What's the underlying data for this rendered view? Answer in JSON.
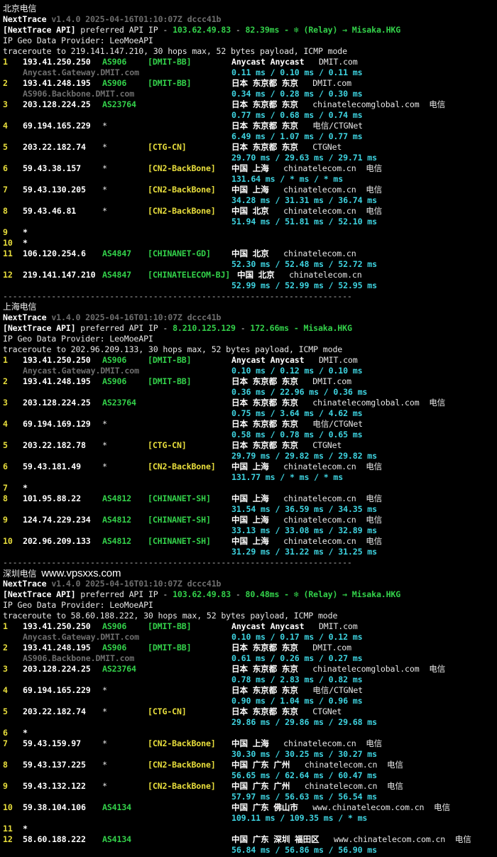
{
  "sections": [
    {
      "title": "北京电信",
      "watermark": "",
      "version_line": {
        "name": "NextTrace",
        "version": "v1.4.0 2025-04-16T01:10:07Z dccc41b"
      },
      "api_line": {
        "tag": "[NextTrace API]",
        "mid": " preferred API IP - ",
        "ip": "103.62.49.83",
        "dash": " - ",
        "latency": "82.39ms",
        "tail": " - ❄ (Relay) → Misaka.HKG"
      },
      "provider_line": "IP Geo Data Provider: LeoMoeAPI",
      "trace_line": "traceroute to 219.141.147.210, 30 hops max, 52 bytes payload, ICMP mode",
      "hops": [
        {
          "n": "1",
          "ip": "193.41.250.250",
          "asn": "AS906",
          "tag": "[DMIT-BB]",
          "loc": "Anycast Anycast",
          "isp": "DMIT.com",
          "carrier": "",
          "host": "Anycast.Gateway.DMIT.com",
          "rtt": "0.11 ms / 0.10 ms / 0.11 ms",
          "tag_color": "g"
        },
        {
          "n": "2",
          "ip": "193.41.248.195",
          "asn": "AS906",
          "tag": "[DMIT-BB]",
          "loc": "日本 东京都 东京",
          "isp": "DMIT.com",
          "carrier": "",
          "host": "AS906.Backbone.DMIT.com",
          "rtt": "0.34 ms / 0.28 ms / 0.30 ms",
          "tag_color": "g"
        },
        {
          "n": "3",
          "ip": "203.128.224.25",
          "asn": "AS23764",
          "tag": "",
          "loc": "日本 东京都 东京",
          "isp": "chinatelecomglobal.com",
          "carrier": "电信",
          "host": "",
          "rtt": "0.77 ms / 0.68 ms / 0.74 ms",
          "tag_color": "g"
        },
        {
          "n": "4",
          "ip": "69.194.165.229",
          "asn": "*",
          "tag": "",
          "loc": "日本 东京都 东京",
          "isp": "电信/CTGNet",
          "carrier": "",
          "host": "",
          "rtt": "6.49 ms / 1.07 ms / 0.77 ms",
          "tag_color": "g"
        },
        {
          "n": "5",
          "ip": "203.22.182.74",
          "asn": "*",
          "tag": "[CTG-CN]",
          "loc": "日本 东京都 东京",
          "isp": "CTGNet",
          "carrier": "",
          "host": "",
          "rtt": "29.70 ms / 29.63 ms / 29.71 ms",
          "tag_color": "y"
        },
        {
          "n": "6",
          "ip": "59.43.38.157",
          "asn": "*",
          "tag": "[CN2-BackBone]",
          "loc": "中国 上海",
          "isp": "chinatelecom.cn",
          "carrier": "电信",
          "host": "",
          "rtt": "131.64 ms / * ms / * ms",
          "tag_color": "y"
        },
        {
          "n": "7",
          "ip": "59.43.130.205",
          "asn": "*",
          "tag": "[CN2-BackBone]",
          "loc": "中国 上海",
          "isp": "chinatelecom.cn",
          "carrier": "电信",
          "host": "",
          "rtt": "34.28 ms / 31.31 ms / 36.74 ms",
          "tag_color": "y"
        },
        {
          "n": "8",
          "ip": "59.43.46.81",
          "asn": "*",
          "tag": "[CN2-BackBone]",
          "loc": "中国 北京",
          "isp": "chinatelecom.cn",
          "carrier": "电信",
          "host": "",
          "rtt": "51.94 ms / 51.81 ms / 52.10 ms",
          "tag_color": "y"
        },
        {
          "n": "9",
          "ip": "*",
          "timeout": true
        },
        {
          "n": "10",
          "ip": "*",
          "timeout": true
        },
        {
          "n": "11",
          "ip": "106.120.254.6",
          "asn": "AS4847",
          "tag": "[CHINANET-GD]",
          "loc": "中国 北京",
          "isp": "chinatelecom.cn",
          "carrier": "",
          "host": "",
          "rtt": "52.30 ms / 52.48 ms / 52.72 ms",
          "tag_color": "g",
          "blank_before_rtt": true
        },
        {
          "n": "12",
          "ip": "219.141.147.210",
          "asn": "AS4847",
          "tag": "[CHINATELECOM-BJ]",
          "loc": "中国 北京",
          "isp": "chinatelecom.cn",
          "carrier": "",
          "host": "",
          "rtt": "52.99 ms / 52.99 ms / 52.95 ms",
          "tag_color": "g",
          "wide": true
        }
      ]
    },
    {
      "title": "上海电信",
      "watermark": "",
      "version_line": {
        "name": "NextTrace",
        "version": "v1.4.0 2025-04-16T01:10:07Z dccc41b"
      },
      "api_line": {
        "tag": "[NextTrace API]",
        "mid": " preferred API IP - ",
        "ip": "8.210.125.129",
        "dash": " - ",
        "latency": "172.66ms",
        "tail": " - Misaka.HKG"
      },
      "provider_line": "IP Geo Data Provider: LeoMoeAPI",
      "trace_line": "traceroute to 202.96.209.133, 30 hops max, 52 bytes payload, ICMP mode",
      "hops": [
        {
          "n": "1",
          "ip": "193.41.250.250",
          "asn": "AS906",
          "tag": "[DMIT-BB]",
          "loc": "Anycast Anycast",
          "isp": "DMIT.com",
          "carrier": "",
          "host": "Anycast.Gateway.DMIT.com",
          "rtt": "0.10 ms / 0.12 ms / 0.10 ms",
          "tag_color": "g"
        },
        {
          "n": "2",
          "ip": "193.41.248.195",
          "asn": "AS906",
          "tag": "[DMIT-BB]",
          "loc": "日本 东京都 东京",
          "isp": "DMIT.com",
          "carrier": "",
          "host": "",
          "rtt": "0.36 ms / 22.96 ms / 0.36 ms",
          "tag_color": "g"
        },
        {
          "n": "3",
          "ip": "203.128.224.25",
          "asn": "AS23764",
          "tag": "",
          "loc": "日本 东京都 东京",
          "isp": "chinatelecomglobal.com",
          "carrier": "电信",
          "host": "",
          "rtt": "0.75 ms / 3.64 ms / 4.62 ms",
          "tag_color": "g"
        },
        {
          "n": "4",
          "ip": "69.194.169.129",
          "asn": "*",
          "tag": "",
          "loc": "日本 东京都 东京",
          "isp": "电信/CTGNet",
          "carrier": "",
          "host": "",
          "rtt": "0.58 ms / 0.78 ms / 0.65 ms",
          "tag_color": "g"
        },
        {
          "n": "5",
          "ip": "203.22.182.78",
          "asn": "*",
          "tag": "[CTG-CN]",
          "loc": "日本 东京都 东京",
          "isp": "CTGNet",
          "carrier": "",
          "host": "",
          "rtt": "29.79 ms / 29.82 ms / 29.82 ms",
          "tag_color": "y"
        },
        {
          "n": "6",
          "ip": "59.43.181.49",
          "asn": "*",
          "tag": "[CN2-BackBone]",
          "loc": "中国 上海",
          "isp": "chinatelecom.cn",
          "carrier": "电信",
          "host": "",
          "rtt": "131.77 ms / * ms / * ms",
          "tag_color": "y"
        },
        {
          "n": "7",
          "ip": "*",
          "timeout": true
        },
        {
          "n": "8",
          "ip": "101.95.88.22",
          "asn": "AS4812",
          "tag": "[CHINANET-SH]",
          "loc": "中国 上海",
          "isp": "chinatelecom.cn",
          "carrier": "电信",
          "host": "",
          "rtt": "31.54 ms / 36.59 ms / 34.35 ms",
          "tag_color": "g"
        },
        {
          "n": "9",
          "ip": "124.74.229.234",
          "asn": "AS4812",
          "tag": "[CHINANET-SH]",
          "loc": "中国 上海",
          "isp": "chinatelecom.cn",
          "carrier": "电信",
          "host": "",
          "rtt": "33.13 ms / 33.08 ms / 32.89 ms",
          "tag_color": "g"
        },
        {
          "n": "10",
          "ip": "202.96.209.133",
          "asn": "AS4812",
          "tag": "[CHINANET-SH]",
          "loc": "中国 上海",
          "isp": "chinatelecom.cn",
          "carrier": "电信",
          "host": "",
          "rtt": "31.29 ms / 31.22 ms / 31.25 ms",
          "tag_color": "g"
        }
      ]
    },
    {
      "title": "深圳电信",
      "watermark": "www.vpsxxs.com",
      "version_line": {
        "name": "NextTrace",
        "version": "v1.4.0 2025-04-16T01:10:07Z dccc41b"
      },
      "api_line": {
        "tag": "[NextTrace API]",
        "mid": " preferred API IP - ",
        "ip": "103.62.49.83",
        "dash": " - ",
        "latency": "80.48ms",
        "tail": " - ❄ (Relay) → Misaka.HKG"
      },
      "provider_line": "IP Geo Data Provider: LeoMoeAPI",
      "trace_line": "traceroute to 58.60.188.222, 30 hops max, 52 bytes payload, ICMP mode",
      "hops": [
        {
          "n": "1",
          "ip": "193.41.250.250",
          "asn": "AS906",
          "tag": "[DMIT-BB]",
          "loc": "Anycast Anycast",
          "isp": "DMIT.com",
          "carrier": "",
          "host": "Anycast.Gateway.DMIT.com",
          "rtt": "0.10 ms / 0.17 ms / 0.12 ms",
          "tag_color": "g"
        },
        {
          "n": "2",
          "ip": "193.41.248.195",
          "asn": "AS906",
          "tag": "[DMIT-BB]",
          "loc": "日本 东京都 东京",
          "isp": "DMIT.com",
          "carrier": "",
          "host": "AS906.Backbone.DMIT.com",
          "rtt": "0.61 ms / 0.26 ms / 0.27 ms",
          "tag_color": "g"
        },
        {
          "n": "3",
          "ip": "203.128.224.25",
          "asn": "AS23764",
          "tag": "",
          "loc": "日本 东京都 东京",
          "isp": "chinatelecomglobal.com",
          "carrier": "电信",
          "host": "",
          "rtt": "0.78 ms / 2.83 ms / 0.82 ms",
          "tag_color": "g"
        },
        {
          "n": "4",
          "ip": "69.194.165.229",
          "asn": "*",
          "tag": "",
          "loc": "日本 东京都 东京",
          "isp": "电信/CTGNet",
          "carrier": "",
          "host": "",
          "rtt": "0.90 ms / 1.04 ms / 0.96 ms",
          "tag_color": "g"
        },
        {
          "n": "5",
          "ip": "203.22.182.74",
          "asn": "*",
          "tag": "[CTG-CN]",
          "loc": "日本 东京都 东京",
          "isp": "CTGNet",
          "carrier": "",
          "host": "",
          "rtt": "29.86 ms / 29.86 ms / 29.68 ms",
          "tag_color": "y"
        },
        {
          "n": "6",
          "ip": "*",
          "timeout": true
        },
        {
          "n": "7",
          "ip": "59.43.159.97",
          "asn": "*",
          "tag": "[CN2-BackBone]",
          "loc": "中国 上海",
          "isp": "chinatelecom.cn",
          "carrier": "电信",
          "host": "",
          "rtt": "30.30 ms / 30.25 ms / 30.27 ms",
          "tag_color": "y"
        },
        {
          "n": "8",
          "ip": "59.43.137.225",
          "asn": "*",
          "tag": "[CN2-BackBone]",
          "loc": "中国 广东 广州",
          "isp": "chinatelecom.cn",
          "carrier": "电信",
          "host": "",
          "rtt": "56.65 ms / 62.64 ms / 60.47 ms",
          "tag_color": "y"
        },
        {
          "n": "9",
          "ip": "59.43.132.122",
          "asn": "*",
          "tag": "[CN2-BackBone]",
          "loc": "中国 广东 广州",
          "isp": "chinatelecom.cn",
          "carrier": "电信",
          "host": "",
          "rtt": "57.97 ms / 56.63 ms / 56.54 ms",
          "tag_color": "y"
        },
        {
          "n": "10",
          "ip": "59.38.104.106",
          "asn": "AS4134",
          "tag": "",
          "loc": "中国 广东 佛山市",
          "isp": "www.chinatelecom.com.cn",
          "carrier": "电信",
          "host": "",
          "rtt": "109.11 ms / 109.35 ms / * ms",
          "tag_color": "g"
        },
        {
          "n": "11",
          "ip": "*",
          "timeout": true
        },
        {
          "n": "12",
          "ip": "58.60.188.222",
          "asn": "AS4134",
          "tag": "",
          "loc": "中国 广东 深圳 福田区",
          "isp": "www.chinatelecom.com.cn",
          "carrier": "电信",
          "host": "",
          "rtt": "56.84 ms / 56.86 ms / 56.90 ms",
          "tag_color": "g"
        }
      ]
    }
  ],
  "separator": "------------------------------------------------------------------------",
  "colors": {
    "background": "#000000",
    "asn": "#33d14a",
    "tag_yellow": "#e8de3c",
    "rtt": "#3ed3e0",
    "host": "#6e6e6e"
  }
}
